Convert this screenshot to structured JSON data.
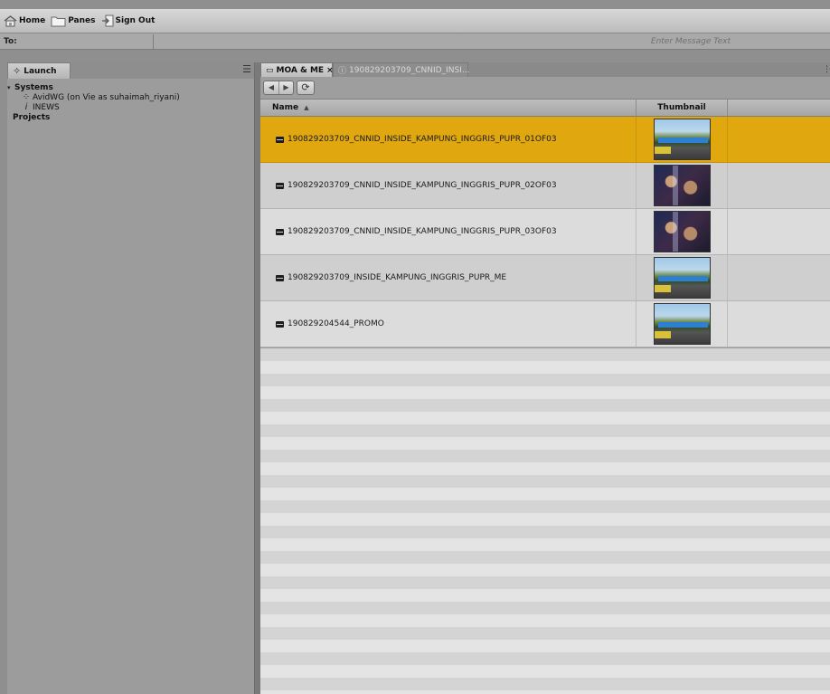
{
  "toolbar": {
    "home_label": "Home",
    "panes_label": "Panes",
    "signout_label": "Sign Out"
  },
  "message_bar": {
    "to_label": "To:",
    "placeholder": "Enter Message Text"
  },
  "launch_pane": {
    "tab_label": "Launch",
    "tree": [
      {
        "label": "Systems",
        "bold": true,
        "expanded": true,
        "icon": "triangle-down-icon"
      },
      {
        "label": "AvidWG (on Vie as suhaimah_riyani)",
        "icon": "network-icon"
      },
      {
        "label": "INEWS",
        "icon": "inews-icon"
      },
      {
        "label": "Projects",
        "bold": true
      }
    ]
  },
  "browser": {
    "tabs": [
      {
        "label": "MOA & ME",
        "active": true,
        "icon": "folder-icon",
        "closable": true
      },
      {
        "label": "190829203709_CNNID_INSI...",
        "active": false,
        "icon": "info-icon"
      }
    ],
    "columns": {
      "name": "Name",
      "sort_indicator": "▲",
      "thumbnail": "Thumbnail"
    },
    "rows": [
      {
        "name": "190829203709_CNNID_INSIDE_KAMPUNG_INGGRIS_PUPR_01OF03",
        "selected": true,
        "thumbnail": "street-scene"
      },
      {
        "name": "190829203709_CNNID_INSIDE_KAMPUNG_INGGRIS_PUPR_02OF03",
        "selected": false,
        "thumbnail": "crowd-scene"
      },
      {
        "name": "190829203709_CNNID_INSIDE_KAMPUNG_INGGRIS_PUPR_03OF03",
        "selected": false,
        "thumbnail": "crowd-scene"
      },
      {
        "name": "190829203709_INSIDE_KAMPUNG_INGGRIS_PUPR_ME",
        "selected": false,
        "thumbnail": "street-scene"
      },
      {
        "name": "190829204544_PROMO",
        "selected": false,
        "thumbnail": "street-scene"
      }
    ]
  },
  "colors": {
    "selected_row": "#e0a70f",
    "pane_background": "#9c9c9c"
  }
}
